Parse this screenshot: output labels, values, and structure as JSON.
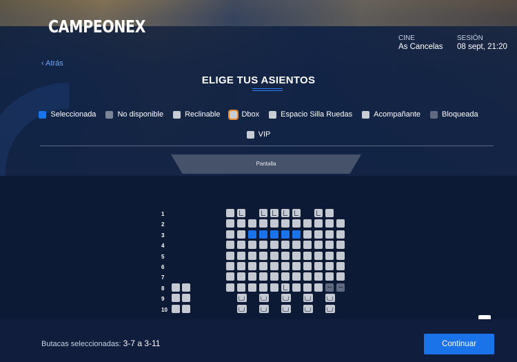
{
  "header": {
    "logo": "CAMPEONEX",
    "cinema_label": "CINE",
    "cinema_value": "As Cancelas",
    "session_label": "SESIÓN",
    "session_value": "08 sept, 21:20"
  },
  "nav": {
    "back_label": "‹ Atrás"
  },
  "page": {
    "title": "ELIGE TUS ASIENTOS"
  },
  "legend": [
    {
      "label": "Seleccionada",
      "icon": "selected-seat-icon",
      "color": "#1a73e8"
    },
    {
      "label": "No disponible",
      "icon": "unavailable-seat-icon",
      "color": "#7d8698"
    },
    {
      "label": "Reclinable",
      "icon": "reclining-seat-icon",
      "color": "#c8ccd4"
    },
    {
      "label": "Dbox",
      "icon": "dbox-seat-icon",
      "color": "#e58a2e"
    },
    {
      "label": "Espacio Silla Ruedas",
      "icon": "wheelchair-icon",
      "color": "#c8ccd4"
    },
    {
      "label": "Acompañante",
      "icon": "companion-seat-icon",
      "color": "#c8ccd4"
    },
    {
      "label": "Bloqueada",
      "icon": "blocked-seat-icon",
      "color": "#5f6a80"
    },
    {
      "label": "VIP",
      "icon": "vip-seat-icon",
      "color": "#c8ccd4"
    }
  ],
  "screen_label": "Pantalla",
  "row_numbers": [
    "1",
    "2",
    "3",
    "4",
    "5",
    "6",
    "7",
    "8",
    "9",
    "10"
  ],
  "selection": {
    "prefix": "Butacas seleccionadas: ",
    "value": "3-7 a 3-11"
  },
  "footer": {
    "continue_label": "Continuar"
  }
}
